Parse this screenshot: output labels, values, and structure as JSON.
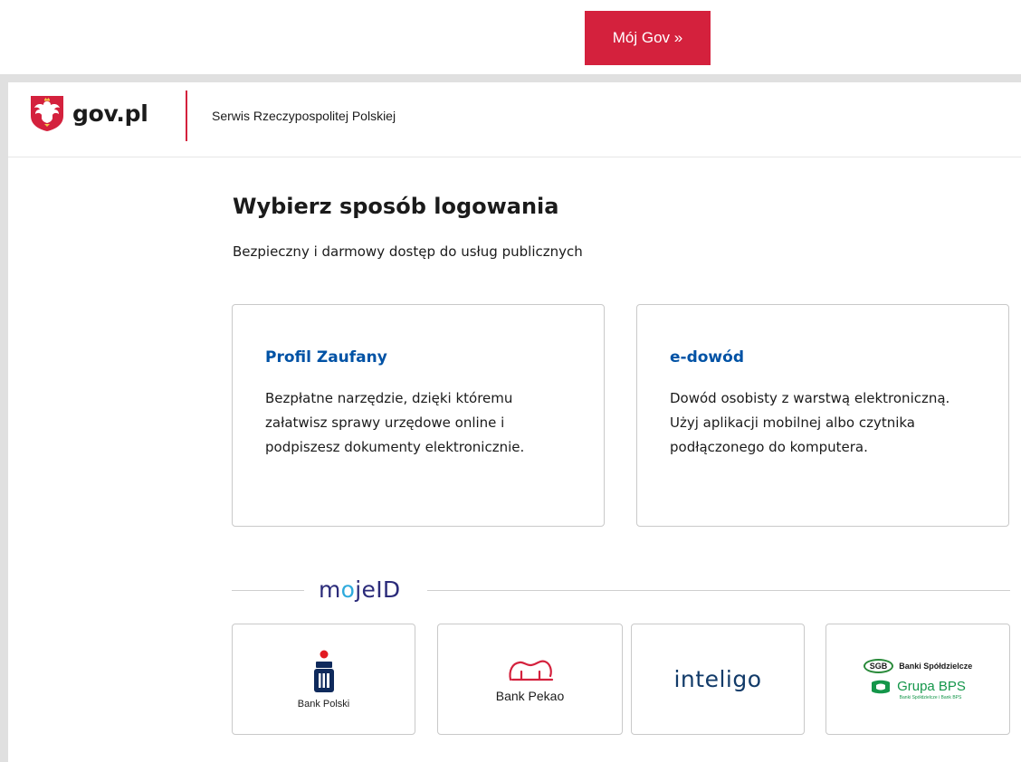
{
  "moj_gov": {
    "label": "Mój Gov »"
  },
  "header": {
    "logo_text": "gov.pl",
    "service_name": "Serwis Rzeczypospolitej Polskiej"
  },
  "main": {
    "title": "Wybierz sposób logowania",
    "subtitle": "Bezpieczny i darmowy dostęp do usług publicznych",
    "cards": [
      {
        "title": "Profil Zaufany",
        "description": "Bezpłatne narzędzie, dzięki któremu załatwisz sprawy urzędowe online i podpiszesz dokumenty elektronicznie."
      },
      {
        "title": "e-dowód",
        "description": "Dowód osobisty z warstwą elektroniczną. Użyj aplikacji mobilnej albo czytnika podłączonego do komputera."
      }
    ],
    "mojeid_label": "mojeID",
    "banks": [
      {
        "name": "Bank Polski",
        "icon": "pko-bank-polski-logo"
      },
      {
        "name": "Bank Pekao",
        "icon": "bank-pekao-bison-logo"
      },
      {
        "name": "inteligo",
        "icon": "inteligo-logo"
      },
      {
        "name": "Grupa BPS",
        "top": "Banki Spółdzielcze",
        "badge": "SGB",
        "sub": "Banki Spółdzielcze i Bank BPS",
        "icon": "grupa-bps-logo"
      }
    ]
  },
  "colors": {
    "brand_red": "#d4213d",
    "link_blue": "#0052a5",
    "mojeid_navy": "#2b2b7a",
    "mojeid_accent": "#2eaadc",
    "bps_green": "#14964a"
  }
}
